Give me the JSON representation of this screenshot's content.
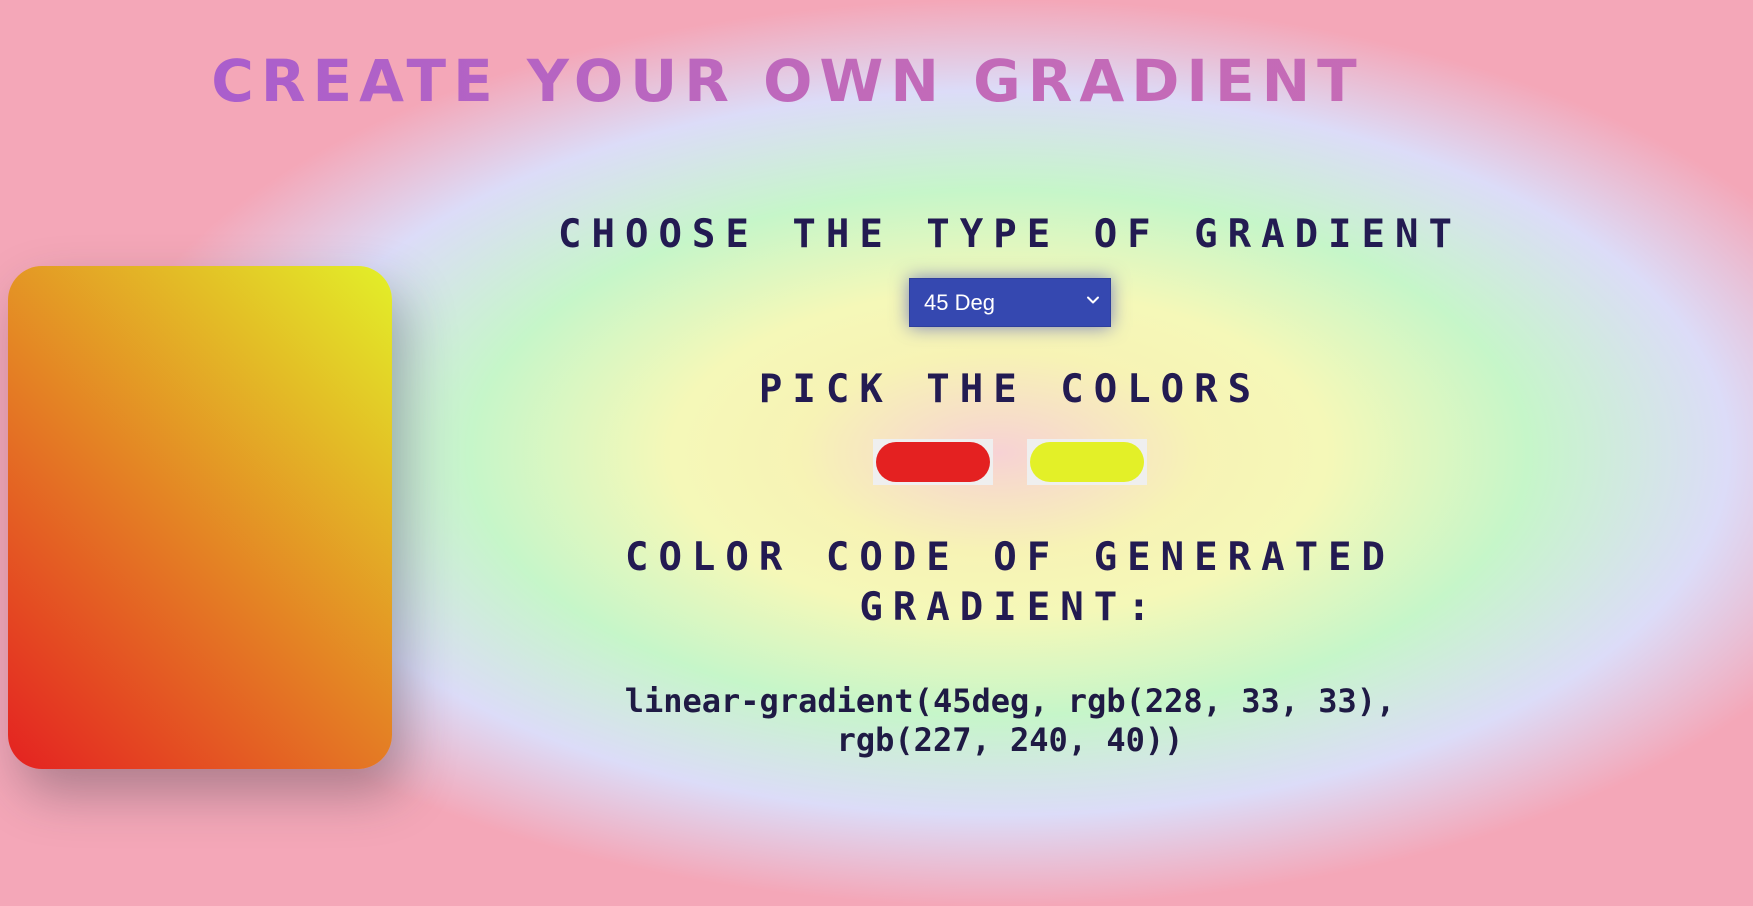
{
  "title": "CREATE YOUR OWN GRADIENT",
  "type_section": {
    "heading": "CHOOSE THE TYPE OF GRADIENT",
    "selected": "45 Deg",
    "accent_color": "#3548b0"
  },
  "colors_section": {
    "heading": "PICK THE COLORS",
    "color1": "#e42121",
    "color2": "#e3f028"
  },
  "code_section": {
    "heading": "COLOR CODE OF GENERATED GRADIENT:",
    "code": "linear-gradient(45deg, rgb(228, 33, 33), rgb(227, 240, 40))"
  },
  "preview": {
    "angle": "45deg",
    "start_color": "#e42121",
    "end_color": "#e3f028"
  }
}
